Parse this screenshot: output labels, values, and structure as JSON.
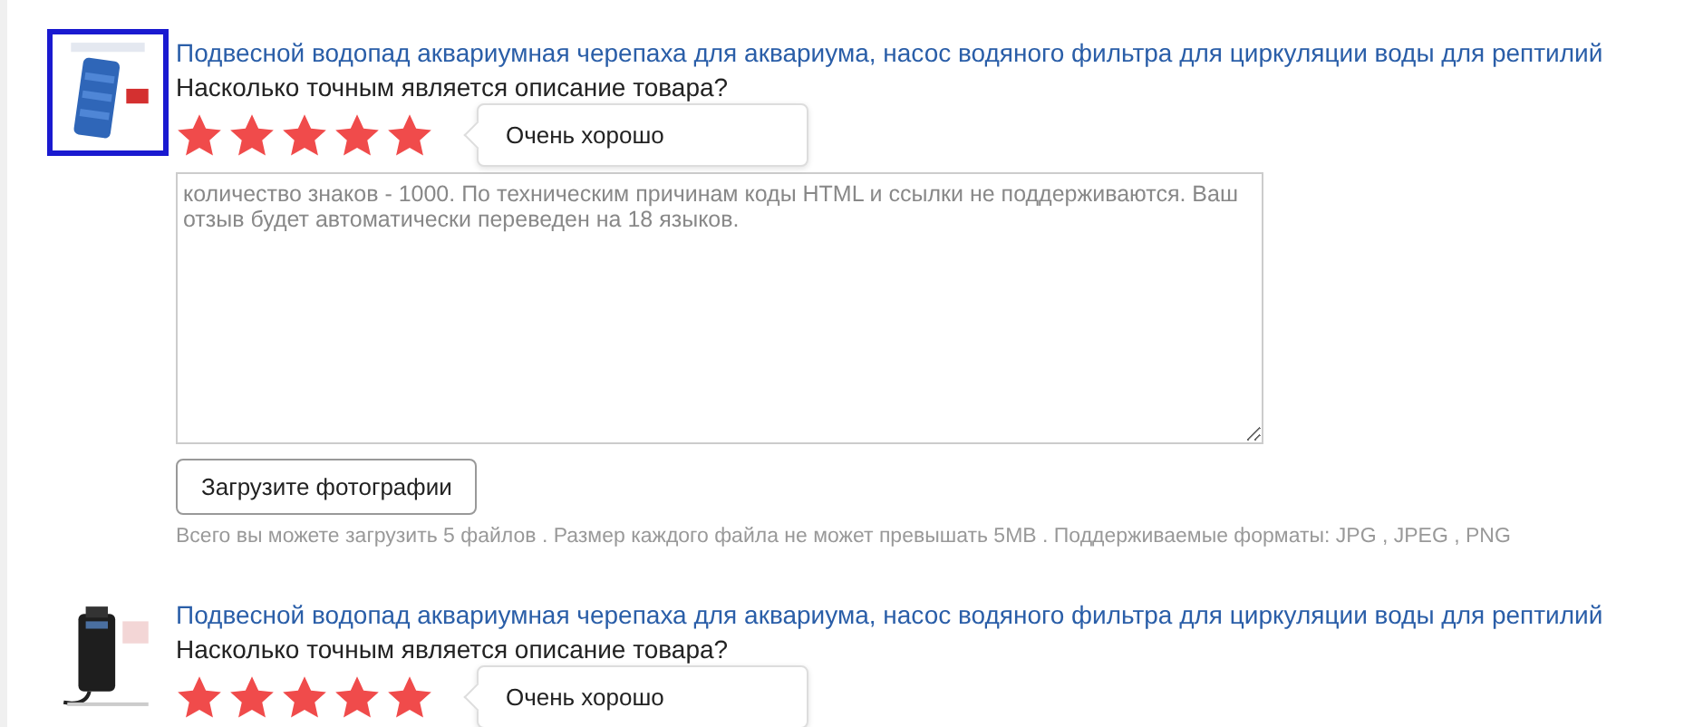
{
  "items": [
    {
      "selected": true,
      "title": "Подвесной водопад аквариумная черепаха для аквариума, насос водяного фильтра для циркуляции воды для рептилий",
      "question": "Насколько точным является описание товара?",
      "stars": 5,
      "rating_label": "Очень хорошо",
      "review": {
        "placeholder": "количество знаков - 1000. По техническим причинам коды HTML и ссылки не поддерживаются. Ваш отзыв будет автоматически переведен на 18 языков."
      },
      "upload_button": "Загрузите фотографии",
      "upload_note": "Всего вы можете загрузить 5 файлов . Размер каждого файла не может превышать 5MB . Поддерживаемые форматы: JPG , JPEG , PNG"
    },
    {
      "selected": false,
      "title": "Подвесной водопад аквариумная черепаха для аквариума, насос водяного фильтра для циркуляции воды для рептилий",
      "question": "Насколько точным является описание товара?",
      "stars": 5,
      "rating_label": "Очень хорошо"
    }
  ]
}
